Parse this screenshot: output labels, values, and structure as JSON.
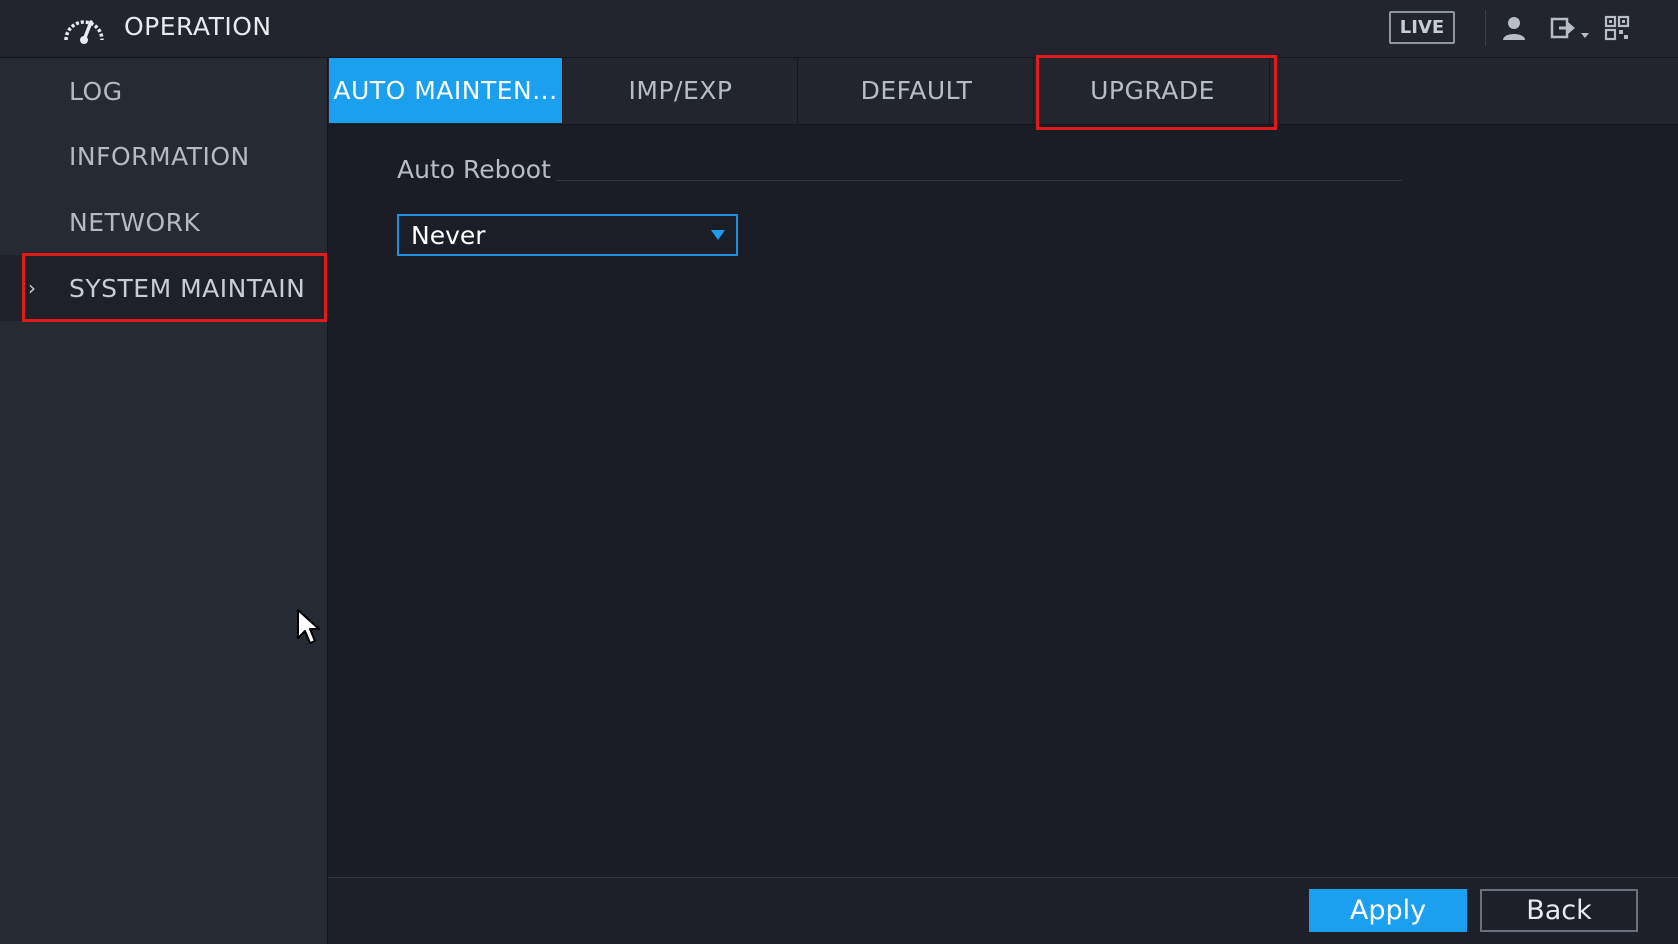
{
  "header": {
    "title": "OPERATION",
    "icon": "speedometer-icon",
    "live_label": "LIVE",
    "right_icons": [
      "user-icon",
      "logout-icon",
      "qr-grid-icon"
    ]
  },
  "sidebar": {
    "items": [
      {
        "label": "LOG"
      },
      {
        "label": "INFORMATION"
      },
      {
        "label": "NETWORK"
      },
      {
        "label": "SYSTEM MAINTAIN",
        "active": true
      }
    ]
  },
  "tabs": [
    {
      "label": "AUTO MAINTEN...",
      "active": true
    },
    {
      "label": "IMP/EXP"
    },
    {
      "label": "DEFAULT"
    },
    {
      "label": "UPGRADE",
      "highlighted": true
    }
  ],
  "content": {
    "section_label": "Auto Reboot",
    "reboot_select": {
      "value": "Never"
    }
  },
  "footer": {
    "apply_label": "Apply",
    "back_label": "Back"
  },
  "colors": {
    "accent": "#1aa0ee",
    "highlight": "#e01b1b",
    "background": "#1a1d26"
  }
}
